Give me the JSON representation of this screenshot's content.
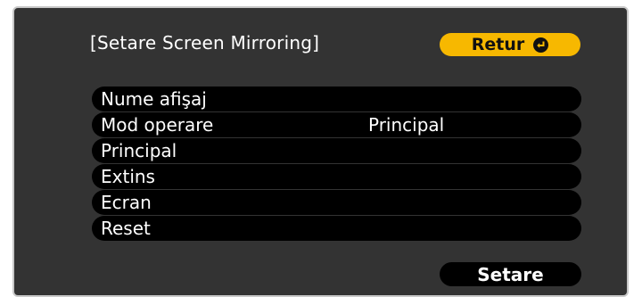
{
  "dialog": {
    "title": "[Setare Screen Mirroring]",
    "return_label": "Retur",
    "return_icon": "enter-icon",
    "set_label": "Setare"
  },
  "menu": {
    "items": [
      {
        "label": "Nume afişaj",
        "value": ""
      },
      {
        "label": "Mod operare",
        "value": "Principal"
      },
      {
        "label": "Principal",
        "value": ""
      },
      {
        "label": "Extins",
        "value": ""
      },
      {
        "label": "Ecran",
        "value": ""
      },
      {
        "label": "Reset",
        "value": ""
      }
    ]
  },
  "colors": {
    "panel_bg": "#333333",
    "item_bg": "#000000",
    "accent": "#f7b800",
    "text": "#ffffff"
  }
}
